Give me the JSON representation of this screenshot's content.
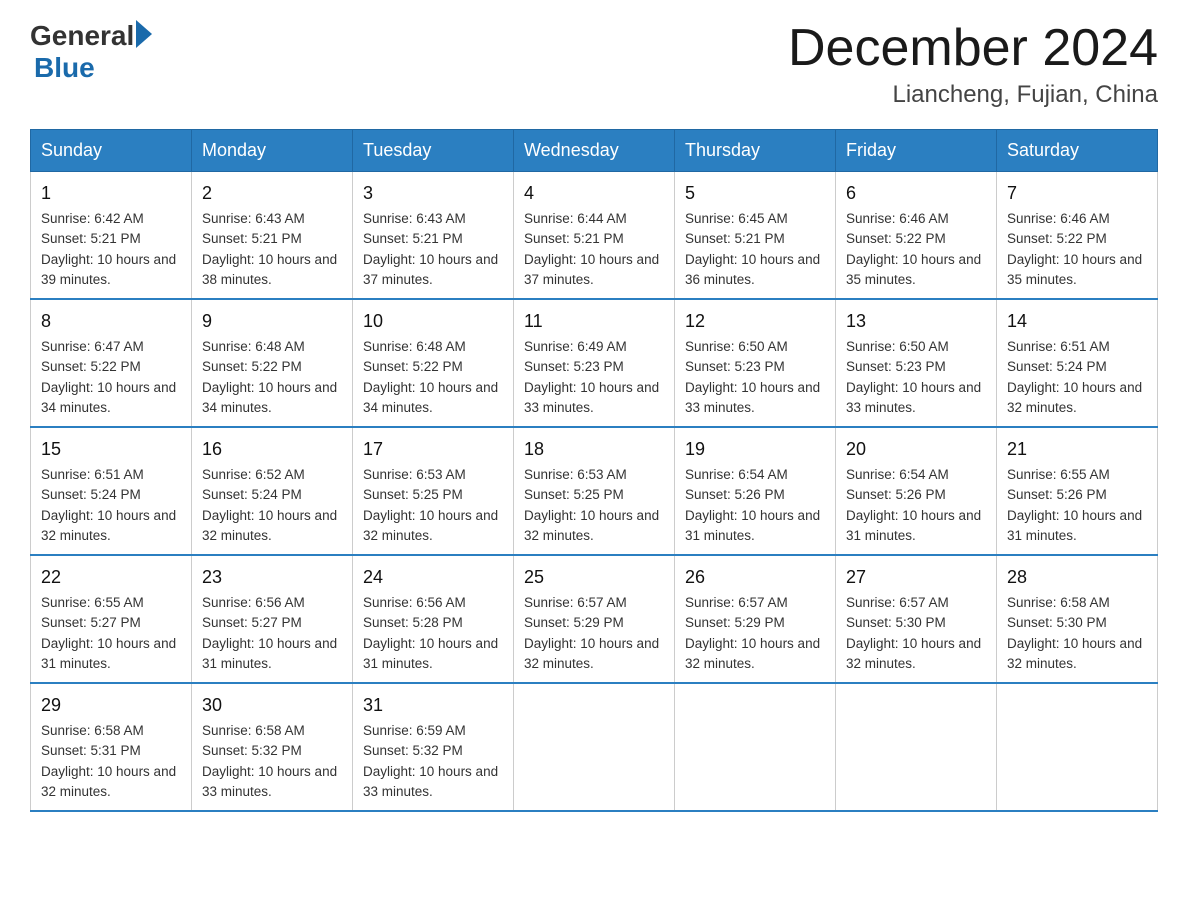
{
  "header": {
    "logo_general": "General",
    "logo_blue": "Blue",
    "title": "December 2024",
    "subtitle": "Liancheng, Fujian, China"
  },
  "calendar": {
    "days_of_week": [
      "Sunday",
      "Monday",
      "Tuesday",
      "Wednesday",
      "Thursday",
      "Friday",
      "Saturday"
    ],
    "weeks": [
      [
        {
          "day": "1",
          "sunrise": "6:42 AM",
          "sunset": "5:21 PM",
          "daylight": "10 hours and 39 minutes."
        },
        {
          "day": "2",
          "sunrise": "6:43 AM",
          "sunset": "5:21 PM",
          "daylight": "10 hours and 38 minutes."
        },
        {
          "day": "3",
          "sunrise": "6:43 AM",
          "sunset": "5:21 PM",
          "daylight": "10 hours and 37 minutes."
        },
        {
          "day": "4",
          "sunrise": "6:44 AM",
          "sunset": "5:21 PM",
          "daylight": "10 hours and 37 minutes."
        },
        {
          "day": "5",
          "sunrise": "6:45 AM",
          "sunset": "5:21 PM",
          "daylight": "10 hours and 36 minutes."
        },
        {
          "day": "6",
          "sunrise": "6:46 AM",
          "sunset": "5:22 PM",
          "daylight": "10 hours and 35 minutes."
        },
        {
          "day": "7",
          "sunrise": "6:46 AM",
          "sunset": "5:22 PM",
          "daylight": "10 hours and 35 minutes."
        }
      ],
      [
        {
          "day": "8",
          "sunrise": "6:47 AM",
          "sunset": "5:22 PM",
          "daylight": "10 hours and 34 minutes."
        },
        {
          "day": "9",
          "sunrise": "6:48 AM",
          "sunset": "5:22 PM",
          "daylight": "10 hours and 34 minutes."
        },
        {
          "day": "10",
          "sunrise": "6:48 AM",
          "sunset": "5:22 PM",
          "daylight": "10 hours and 34 minutes."
        },
        {
          "day": "11",
          "sunrise": "6:49 AM",
          "sunset": "5:23 PM",
          "daylight": "10 hours and 33 minutes."
        },
        {
          "day": "12",
          "sunrise": "6:50 AM",
          "sunset": "5:23 PM",
          "daylight": "10 hours and 33 minutes."
        },
        {
          "day": "13",
          "sunrise": "6:50 AM",
          "sunset": "5:23 PM",
          "daylight": "10 hours and 33 minutes."
        },
        {
          "day": "14",
          "sunrise": "6:51 AM",
          "sunset": "5:24 PM",
          "daylight": "10 hours and 32 minutes."
        }
      ],
      [
        {
          "day": "15",
          "sunrise": "6:51 AM",
          "sunset": "5:24 PM",
          "daylight": "10 hours and 32 minutes."
        },
        {
          "day": "16",
          "sunrise": "6:52 AM",
          "sunset": "5:24 PM",
          "daylight": "10 hours and 32 minutes."
        },
        {
          "day": "17",
          "sunrise": "6:53 AM",
          "sunset": "5:25 PM",
          "daylight": "10 hours and 32 minutes."
        },
        {
          "day": "18",
          "sunrise": "6:53 AM",
          "sunset": "5:25 PM",
          "daylight": "10 hours and 32 minutes."
        },
        {
          "day": "19",
          "sunrise": "6:54 AM",
          "sunset": "5:26 PM",
          "daylight": "10 hours and 31 minutes."
        },
        {
          "day": "20",
          "sunrise": "6:54 AM",
          "sunset": "5:26 PM",
          "daylight": "10 hours and 31 minutes."
        },
        {
          "day": "21",
          "sunrise": "6:55 AM",
          "sunset": "5:26 PM",
          "daylight": "10 hours and 31 minutes."
        }
      ],
      [
        {
          "day": "22",
          "sunrise": "6:55 AM",
          "sunset": "5:27 PM",
          "daylight": "10 hours and 31 minutes."
        },
        {
          "day": "23",
          "sunrise": "6:56 AM",
          "sunset": "5:27 PM",
          "daylight": "10 hours and 31 minutes."
        },
        {
          "day": "24",
          "sunrise": "6:56 AM",
          "sunset": "5:28 PM",
          "daylight": "10 hours and 31 minutes."
        },
        {
          "day": "25",
          "sunrise": "6:57 AM",
          "sunset": "5:29 PM",
          "daylight": "10 hours and 32 minutes."
        },
        {
          "day": "26",
          "sunrise": "6:57 AM",
          "sunset": "5:29 PM",
          "daylight": "10 hours and 32 minutes."
        },
        {
          "day": "27",
          "sunrise": "6:57 AM",
          "sunset": "5:30 PM",
          "daylight": "10 hours and 32 minutes."
        },
        {
          "day": "28",
          "sunrise": "6:58 AM",
          "sunset": "5:30 PM",
          "daylight": "10 hours and 32 minutes."
        }
      ],
      [
        {
          "day": "29",
          "sunrise": "6:58 AM",
          "sunset": "5:31 PM",
          "daylight": "10 hours and 32 minutes."
        },
        {
          "day": "30",
          "sunrise": "6:58 AM",
          "sunset": "5:32 PM",
          "daylight": "10 hours and 33 minutes."
        },
        {
          "day": "31",
          "sunrise": "6:59 AM",
          "sunset": "5:32 PM",
          "daylight": "10 hours and 33 minutes."
        },
        null,
        null,
        null,
        null
      ]
    ]
  }
}
